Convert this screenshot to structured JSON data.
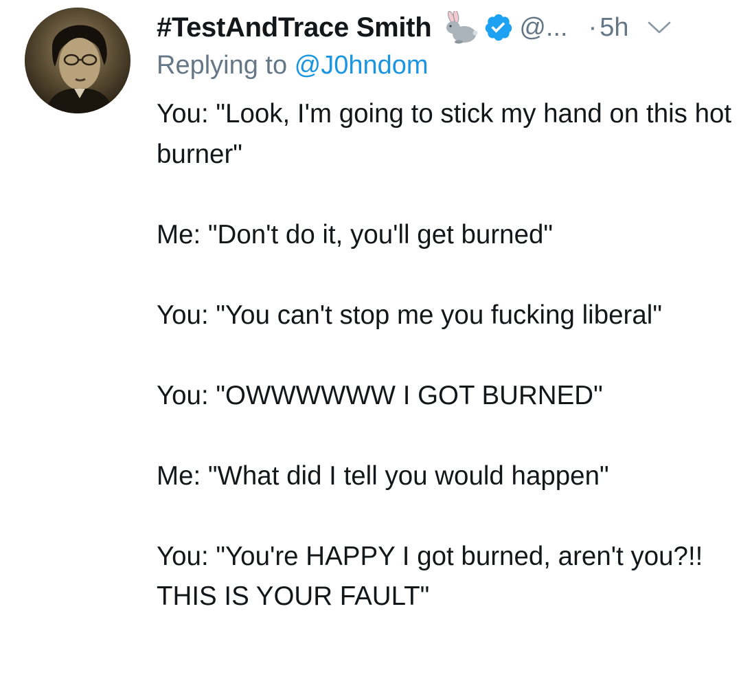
{
  "tweet": {
    "display_name": "#TestAndTrace Smith",
    "name_emoji": "rabbit-icon",
    "verified": true,
    "handle": "@...",
    "separator": "·",
    "time": "5h",
    "replying_label": "Replying to ",
    "replying_to": "@J0hndom",
    "paragraphs": [
      "You: \"Look, I'm going to stick my hand on this hot burner\"",
      "Me: \"Don't do it, you'll get burned\"",
      "You: \"You can't stop me you fucking liberal\"",
      "You: \"OWWWWWW I GOT BURNED\"",
      "Me: \"What did I tell you would happen\"",
      "You: \"You're HAPPY I got burned, aren't you?!! THIS IS YOUR FAULT\""
    ]
  },
  "colors": {
    "text": "#14171a",
    "secondary": "#657786",
    "link": "#1b95e0",
    "verified": "#1da1f2"
  }
}
